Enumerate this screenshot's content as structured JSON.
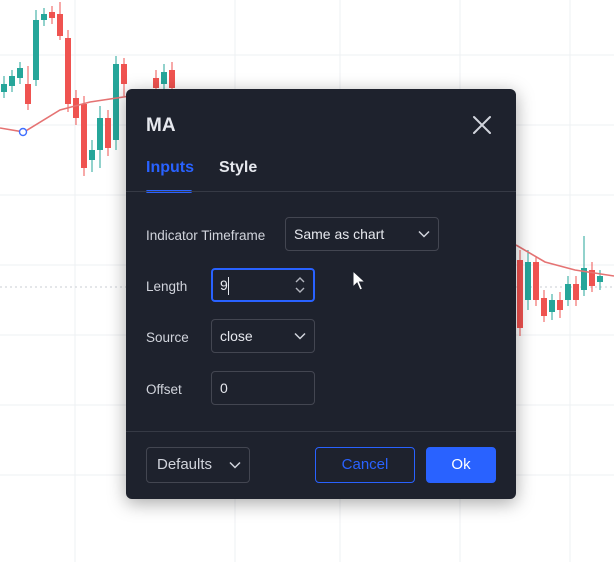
{
  "dialog": {
    "title": "MA",
    "tabs": [
      {
        "label": "Inputs",
        "active": true
      },
      {
        "label": "Style",
        "active": false
      }
    ],
    "fields": {
      "timeframe": {
        "label": "Indicator Timeframe",
        "value": "Same as chart"
      },
      "length": {
        "label": "Length",
        "value": "9"
      },
      "source": {
        "label": "Source",
        "value": "close"
      },
      "offset": {
        "label": "Offset",
        "value": "0"
      }
    },
    "footer": {
      "defaults_label": "Defaults",
      "cancel_label": "Cancel",
      "ok_label": "Ok"
    }
  },
  "colors": {
    "dialog_bg": "#1e222d",
    "accent": "#2962ff",
    "candle_up": "#26a69a",
    "candle_down": "#ef5350",
    "ma_line": "#e57373"
  },
  "icons": {
    "close": "close-icon",
    "chevron": "chevron-down-icon",
    "stepper": "stepper-icon",
    "cursor": "mouse-pointer-icon"
  }
}
